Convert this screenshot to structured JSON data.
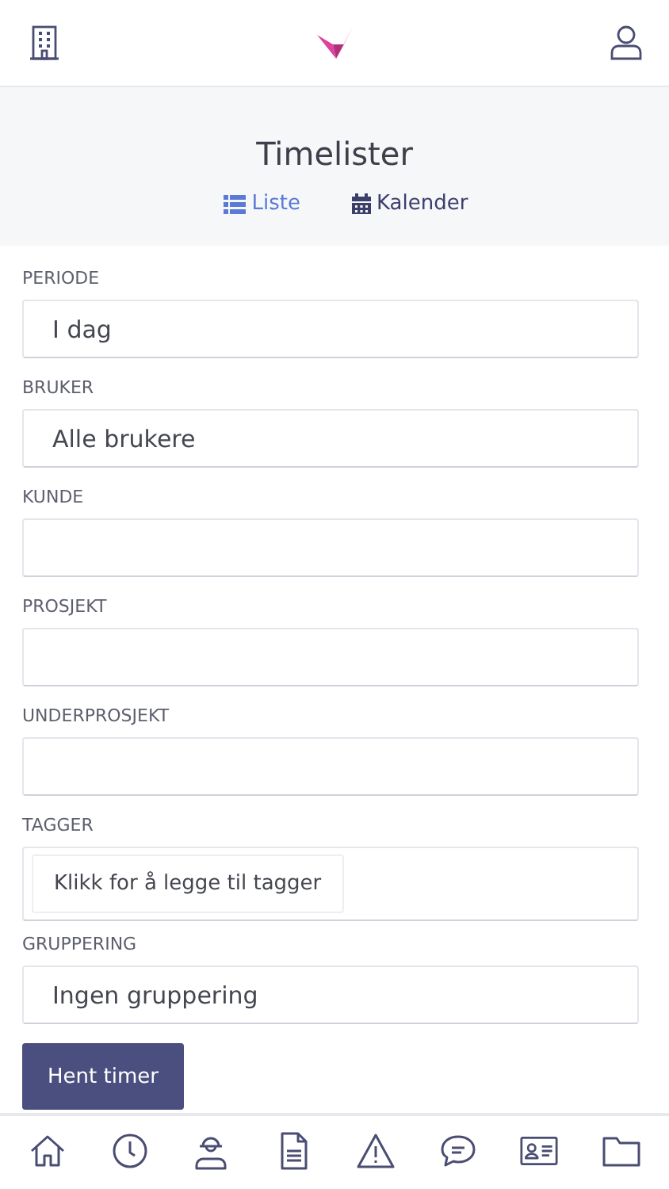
{
  "page": {
    "title": "Timelister"
  },
  "view_tabs": [
    {
      "label": "Liste",
      "selected": true,
      "kind": "list"
    },
    {
      "label": "Kalender",
      "selected": false,
      "kind": "calendar"
    }
  ],
  "filters": [
    {
      "label": "PERIODE",
      "kind": "select",
      "value": "I dag"
    },
    {
      "label": "BRUKER",
      "kind": "select",
      "value": "Alle brukere"
    },
    {
      "label": "KUNDE",
      "kind": "select"
    },
    {
      "label": "PROSJEKT",
      "kind": "select"
    },
    {
      "label": "UNDERPROSJEKT",
      "kind": "select"
    },
    {
      "label": "TAGGER",
      "kind": "tags",
      "button": "Klikk for å legge til tagger"
    },
    {
      "label": "GRUPPERING",
      "kind": "select",
      "value": "Ingen gruppering"
    }
  ],
  "submit_button": "Hent timer"
}
